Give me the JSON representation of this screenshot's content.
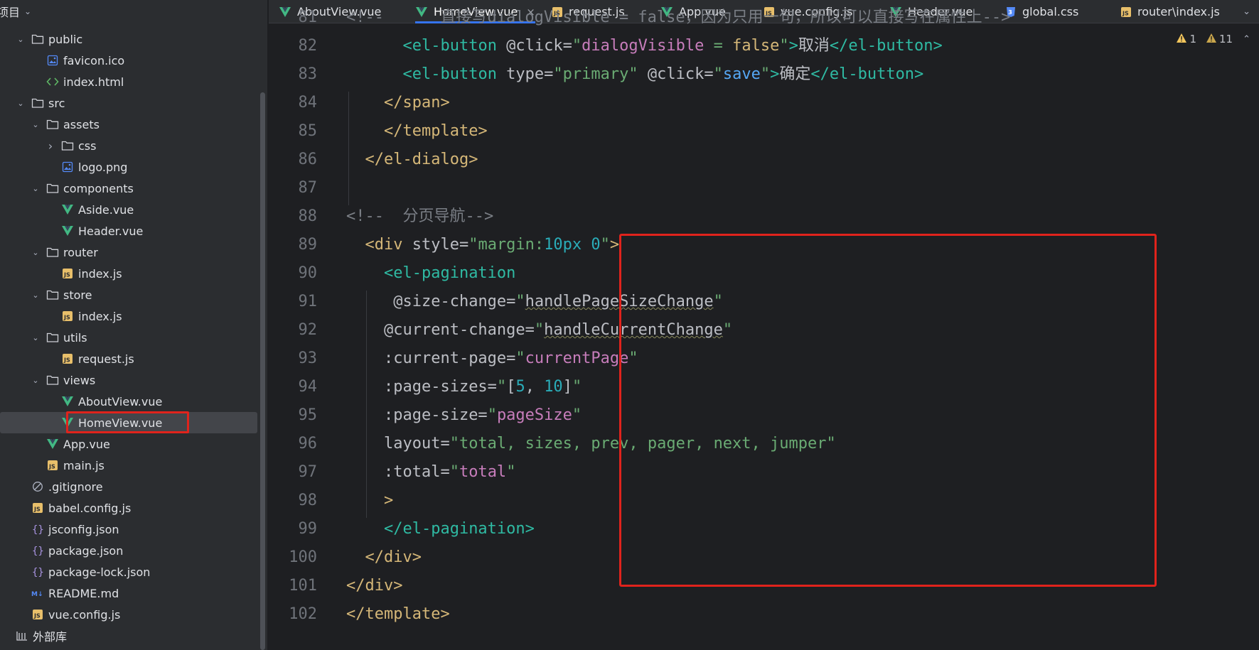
{
  "project_panel": {
    "title": "项目",
    "tree": [
      {
        "label": "public",
        "type": "folder",
        "expanded": true,
        "depth": 1
      },
      {
        "label": "favicon.ico",
        "type": "image",
        "depth": 2
      },
      {
        "label": "index.html",
        "type": "html",
        "depth": 2
      },
      {
        "label": "src",
        "type": "folder",
        "expanded": true,
        "depth": 1
      },
      {
        "label": "assets",
        "type": "folder",
        "expanded": true,
        "depth": 2
      },
      {
        "label": "css",
        "type": "folder",
        "expanded": false,
        "depth": 3
      },
      {
        "label": "logo.png",
        "type": "image",
        "depth": 3
      },
      {
        "label": "components",
        "type": "folder",
        "expanded": true,
        "depth": 2
      },
      {
        "label": "Aside.vue",
        "type": "vue",
        "depth": 3
      },
      {
        "label": "Header.vue",
        "type": "vue",
        "depth": 3
      },
      {
        "label": "router",
        "type": "folder",
        "expanded": true,
        "depth": 2
      },
      {
        "label": "index.js",
        "type": "js",
        "depth": 3
      },
      {
        "label": "store",
        "type": "folder",
        "expanded": true,
        "depth": 2
      },
      {
        "label": "index.js",
        "type": "js",
        "depth": 3
      },
      {
        "label": "utils",
        "type": "folder",
        "expanded": true,
        "depth": 2
      },
      {
        "label": "request.js",
        "type": "js",
        "depth": 3
      },
      {
        "label": "views",
        "type": "folder",
        "expanded": true,
        "depth": 2
      },
      {
        "label": "AboutView.vue",
        "type": "vue",
        "depth": 3
      },
      {
        "label": "HomeView.vue",
        "type": "vue",
        "depth": 3,
        "selected": true
      },
      {
        "label": "App.vue",
        "type": "vue",
        "depth": 2
      },
      {
        "label": "main.js",
        "type": "js",
        "depth": 2
      },
      {
        "label": ".gitignore",
        "type": "ignore",
        "depth": 1
      },
      {
        "label": "babel.config.js",
        "type": "js",
        "depth": 1
      },
      {
        "label": "jsconfig.json",
        "type": "json",
        "depth": 1
      },
      {
        "label": "package.json",
        "type": "json",
        "depth": 1
      },
      {
        "label": "package-lock.json",
        "type": "json",
        "depth": 1
      },
      {
        "label": "README.md",
        "type": "md",
        "depth": 1
      },
      {
        "label": "vue.config.js",
        "type": "js",
        "depth": 1
      },
      {
        "label": "外部库",
        "type": "library",
        "depth": 0
      }
    ]
  },
  "tabs": [
    {
      "label": "AboutView.vue",
      "type": "vue"
    },
    {
      "label": "HomeView.vue",
      "type": "vue",
      "active": true
    },
    {
      "label": "request.js",
      "type": "js"
    },
    {
      "label": "App.vue",
      "type": "vue"
    },
    {
      "label": "vue.config.js",
      "type": "js"
    },
    {
      "label": "Header.vue",
      "type": "vue"
    },
    {
      "label": "global.css",
      "type": "css"
    },
    {
      "label": "router\\index.js",
      "type": "js"
    }
  ],
  "inspections": {
    "warnings_a": "1",
    "warnings_b": "11"
  },
  "colors": {
    "highlight_box": "#e0231c",
    "accent": "#3574f0",
    "vue_green": "#42b883",
    "js_yellow": "#e8bf6a"
  },
  "editor": {
    "line_numbers": [
      "81",
      "82",
      "83",
      "84",
      "85",
      "86",
      "87",
      "88",
      "89",
      "90",
      "91",
      "92",
      "93",
      "94",
      "95",
      "96",
      "97",
      "98",
      "99",
      "100",
      "101",
      "102"
    ],
    "lines": [
      [
        [
          "t-cmt",
          "<!--      直接写dialogVisible = false，因为只用一句，所以可以直接写在属性上-->"
        ]
      ],
      [
        [
          "t-plain",
          "      "
        ],
        [
          "t-eltag",
          "<el-button"
        ],
        [
          "t-attr",
          " @click="
        ],
        [
          "t-str",
          "\""
        ],
        [
          "t-var",
          "dialogVisible"
        ],
        [
          "t-str",
          " = "
        ],
        [
          "t-tag",
          "false"
        ],
        [
          "t-str",
          "\""
        ],
        [
          "t-eltag",
          ">"
        ],
        [
          "t-plain",
          "取消"
        ],
        [
          "t-eltag",
          "</el-button>"
        ]
      ],
      [
        [
          "t-plain",
          "      "
        ],
        [
          "t-eltag",
          "<el-button"
        ],
        [
          "t-attr",
          " type="
        ],
        [
          "t-str",
          "\"primary\""
        ],
        [
          "t-attr",
          " @click="
        ],
        [
          "t-str",
          "\""
        ],
        [
          "t-fn",
          "save"
        ],
        [
          "t-str",
          "\""
        ],
        [
          "t-eltag",
          ">"
        ],
        [
          "t-plain",
          "确定"
        ],
        [
          "t-eltag",
          "</el-button>"
        ]
      ],
      [
        [
          "t-plain",
          "    "
        ],
        [
          "t-tag",
          "</span>"
        ]
      ],
      [
        [
          "t-plain",
          "    "
        ],
        [
          "t-tag",
          "</template>"
        ]
      ],
      [
        [
          "t-plain",
          "  "
        ],
        [
          "t-tag",
          "</el-dialog>"
        ]
      ],
      [
        [
          "t-plain",
          ""
        ]
      ],
      [
        [
          "t-cmt",
          "<!--  分页导航-->"
        ]
      ],
      [
        [
          "t-plain",
          "  "
        ],
        [
          "t-tag",
          "<div"
        ],
        [
          "t-attr",
          " style="
        ],
        [
          "t-str",
          "\"margin:"
        ],
        [
          "t-num",
          "10px"
        ],
        [
          "t-str",
          " "
        ],
        [
          "t-num",
          "0"
        ],
        [
          "t-str",
          "\""
        ],
        [
          "t-tag",
          ">"
        ]
      ],
      [
        [
          "t-plain",
          "    "
        ],
        [
          "t-eltag",
          "<el-pagination"
        ]
      ],
      [
        [
          "t-plain",
          "     "
        ],
        [
          "t-attr",
          "@size-change="
        ],
        [
          "t-str",
          "\""
        ],
        [
          "t-typo",
          "handlePageSizeChange"
        ],
        [
          "t-str",
          "\""
        ]
      ],
      [
        [
          "t-plain",
          "    "
        ],
        [
          "t-attr",
          "@current-change="
        ],
        [
          "t-str",
          "\""
        ],
        [
          "t-typo",
          "handleCurrentChange"
        ],
        [
          "t-str",
          "\""
        ]
      ],
      [
        [
          "t-plain",
          "    "
        ],
        [
          "t-attr",
          ":current-page="
        ],
        [
          "t-str",
          "\""
        ],
        [
          "t-var",
          "currentPage"
        ],
        [
          "t-str",
          "\""
        ]
      ],
      [
        [
          "t-plain",
          "    "
        ],
        [
          "t-attr",
          ":page-sizes="
        ],
        [
          "t-str",
          "\""
        ],
        [
          "t-plain",
          "["
        ],
        [
          "t-num",
          "5"
        ],
        [
          "t-plain",
          ", "
        ],
        [
          "t-num",
          "10"
        ],
        [
          "t-plain",
          "]"
        ],
        [
          "t-str",
          "\""
        ]
      ],
      [
        [
          "t-plain",
          "    "
        ],
        [
          "t-attr",
          ":page-size="
        ],
        [
          "t-str",
          "\""
        ],
        [
          "t-var",
          "pageSize"
        ],
        [
          "t-str",
          "\""
        ]
      ],
      [
        [
          "t-plain",
          "    "
        ],
        [
          "t-attr",
          "layout="
        ],
        [
          "t-str",
          "\"total, sizes, prev, pager, next, jumper\""
        ]
      ],
      [
        [
          "t-plain",
          "    "
        ],
        [
          "t-attr",
          ":total="
        ],
        [
          "t-str",
          "\""
        ],
        [
          "t-var",
          "total"
        ],
        [
          "t-str",
          "\""
        ]
      ],
      [
        [
          "t-plain",
          "    "
        ],
        [
          "t-tag",
          ">"
        ]
      ],
      [
        [
          "t-plain",
          "    "
        ],
        [
          "t-eltag",
          "</el-pagination>"
        ]
      ],
      [
        [
          "t-plain",
          "  "
        ],
        [
          "t-tag",
          "</div>"
        ]
      ],
      [
        [
          "t-tag",
          "</div>"
        ]
      ],
      [
        [
          "t-tag",
          "</template>"
        ]
      ]
    ]
  }
}
